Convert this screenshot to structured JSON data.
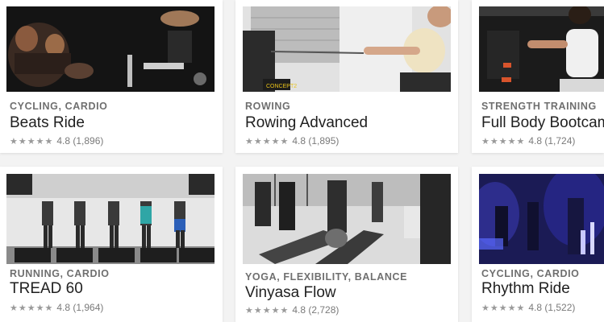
{
  "cards": [
    {
      "category": "CYCLING, CARDIO",
      "title": "Beats Ride",
      "stars": "★★★★★",
      "rating": "4.8",
      "count": "(1,896)"
    },
    {
      "category": "ROWING",
      "title": "Rowing Advanced",
      "stars": "★★★★★",
      "rating": "4.8",
      "count": "(1,895)"
    },
    {
      "category": "STRENGTH TRAINING",
      "title": "Full Body Bootcamp",
      "stars": "★★★★★",
      "rating": "4.8",
      "count": "(1,724)"
    },
    {
      "category": "RUNNING, CARDIO",
      "title": "TREAD 60",
      "stars": "★★★★★",
      "rating": "4.8",
      "count": "(1,964)"
    },
    {
      "category": "YOGA, FLEXIBILITY, BALANCE",
      "title": "Vinyasa Flow",
      "stars": "★★★★★",
      "rating": "4.8",
      "count": "(2,728)"
    },
    {
      "category": "CYCLING, CARDIO",
      "title": "Rhythm Ride",
      "stars": "★★★★★",
      "rating": "4.8",
      "count": "(1,522)"
    }
  ],
  "images": {
    "brand_label": "CONCEPT2"
  },
  "colors": {
    "card_bg": "#ffffff",
    "page_bg": "#f3f3f3",
    "category_text": "#6f6f6f",
    "title_text": "#1f1f1f",
    "rhythm_ride_tint": "#2a2a9a"
  }
}
